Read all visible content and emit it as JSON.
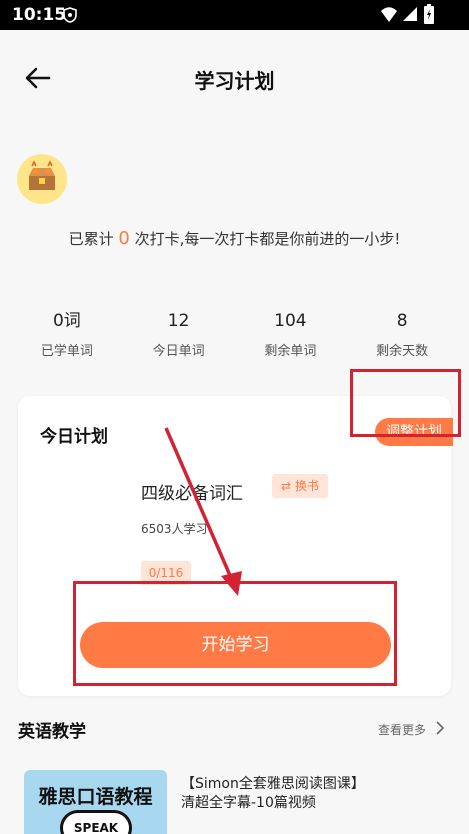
{
  "status_bar": {
    "time": "10:15"
  },
  "header": {
    "title": "学习计划"
  },
  "checkin": {
    "prefix": "已累计",
    "count": "0",
    "suffix": "次打卡,每一次打卡都是你前进的一小步!"
  },
  "stats": [
    {
      "value": "0词",
      "label": "已学单词"
    },
    {
      "value": "12",
      "label": "今日单词"
    },
    {
      "value": "104",
      "label": "剩余单词"
    },
    {
      "value": "8",
      "label": "剩余天数"
    }
  ],
  "plan": {
    "title": "今日计划",
    "adjust_label": "调整计划",
    "book_name": "四级必备词汇",
    "swap_label": "换书",
    "learners": "6503人学习",
    "progress": "0/116",
    "start_label": "开始学习"
  },
  "section": {
    "title": "英语教学",
    "more_label": "查看更多"
  },
  "course": {
    "thumb_title": "雅思口语教程",
    "thumb_badge": "SPEAK",
    "line1": "【Simon全套雅思阅读图课】",
    "line2": "清超全字幕-10篇视频"
  },
  "colors": {
    "accent": "#ff7a45",
    "highlight_box": "#d42233"
  }
}
